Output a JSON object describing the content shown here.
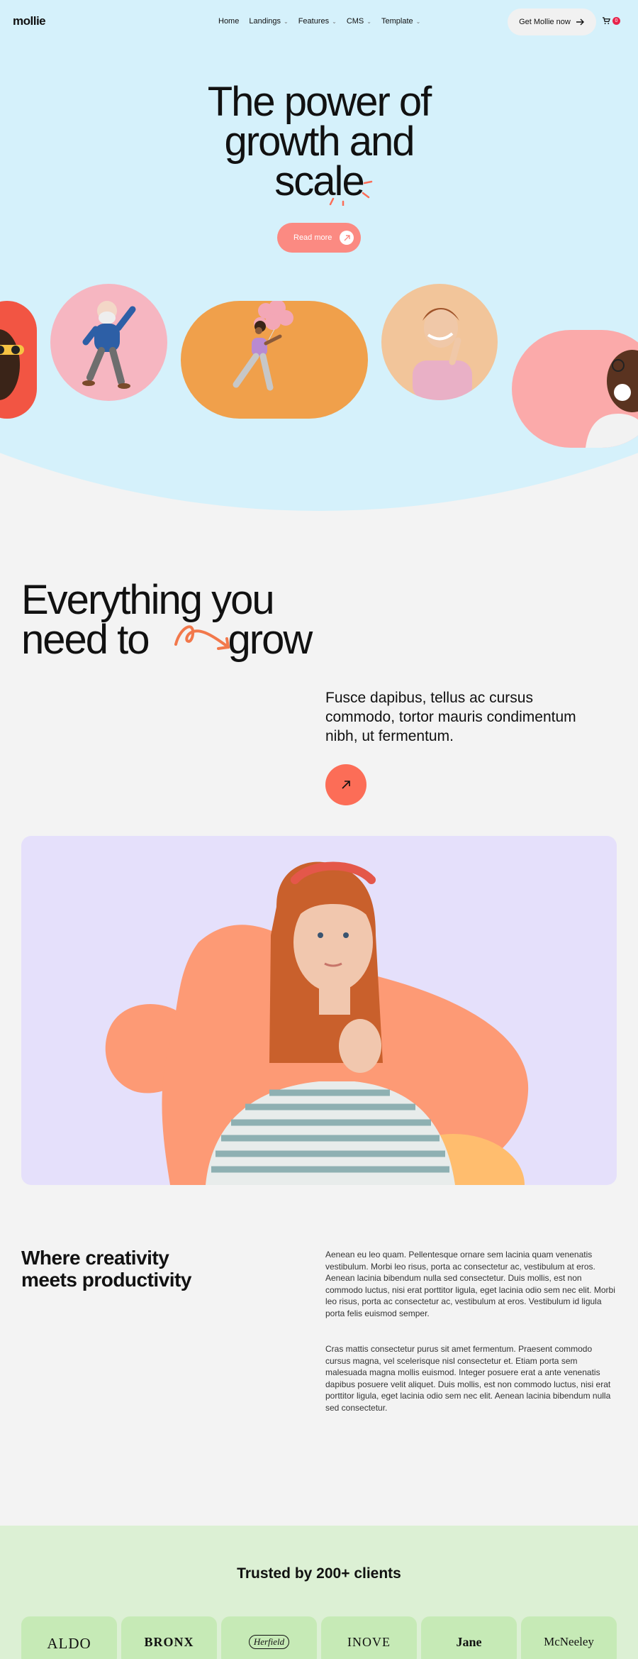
{
  "nav": {
    "logo": "mollie",
    "menu": [
      {
        "label": "Home",
        "has_caret": false
      },
      {
        "label": "Landings",
        "has_caret": true
      },
      {
        "label": "Features",
        "has_caret": true
      },
      {
        "label": "CMS",
        "has_caret": true
      },
      {
        "label": "Template",
        "has_caret": true
      }
    ],
    "cta_label": "Get Mollie now",
    "cart_count": "0"
  },
  "hero": {
    "title_line1": "The power of",
    "title_line2": "growth and",
    "title_line3": "scale",
    "button_label": "Read more"
  },
  "section_grow": {
    "title_line1": "Everything you",
    "title_line2a": "need to",
    "title_line2b": "grow",
    "lead": "Fusce dapibus, tellus ac cursus commodo, tortor mauris condimentum nibh, ut fermentum."
  },
  "section_creativity": {
    "title_line1": "Where creativity",
    "title_line2": "meets productivity",
    "paragraph1": "Aenean eu leo quam. Pellentesque ornare sem lacinia quam venenatis vestibulum. Morbi leo risus, porta ac consectetur ac, vestibulum at eros. Aenean lacinia bibendum nulla sed consectetur. Duis mollis, est non commodo luctus, nisi erat porttitor ligula, eget lacinia odio sem nec elit. Morbi leo risus, porta ac consectetur ac, vestibulum at eros. Vestibulum id ligula porta felis euismod semper.",
    "paragraph2": "Cras mattis consectetur purus sit amet fermentum. Praesent commodo cursus magna, vel scelerisque nisl consectetur et. Etiam porta sem malesuada magna mollis euismod. Integer posuere erat a ante venenatis dapibus posuere velit aliquet. Duis mollis, est non commodo luctus, nisi erat porttitor ligula, eget lacinia odio sem nec elit. Aenean lacinia bibendum nulla sed consectetur."
  },
  "trusted": {
    "title": "Trusted by 200+ clients",
    "clients": [
      "ALDO",
      "BRONX",
      "Herfield",
      "INOVE",
      "Jane",
      "McNeeley"
    ]
  },
  "colors": {
    "hero_bg": "#d5f1fb",
    "page_bg": "#f3f3f3",
    "accent_coral": "#fc6d57",
    "button_salmon": "#fb8a82",
    "feature_lavender": "#e5e0fb",
    "trusted_green": "#dcf0d4",
    "badge_red": "#e8244b"
  }
}
